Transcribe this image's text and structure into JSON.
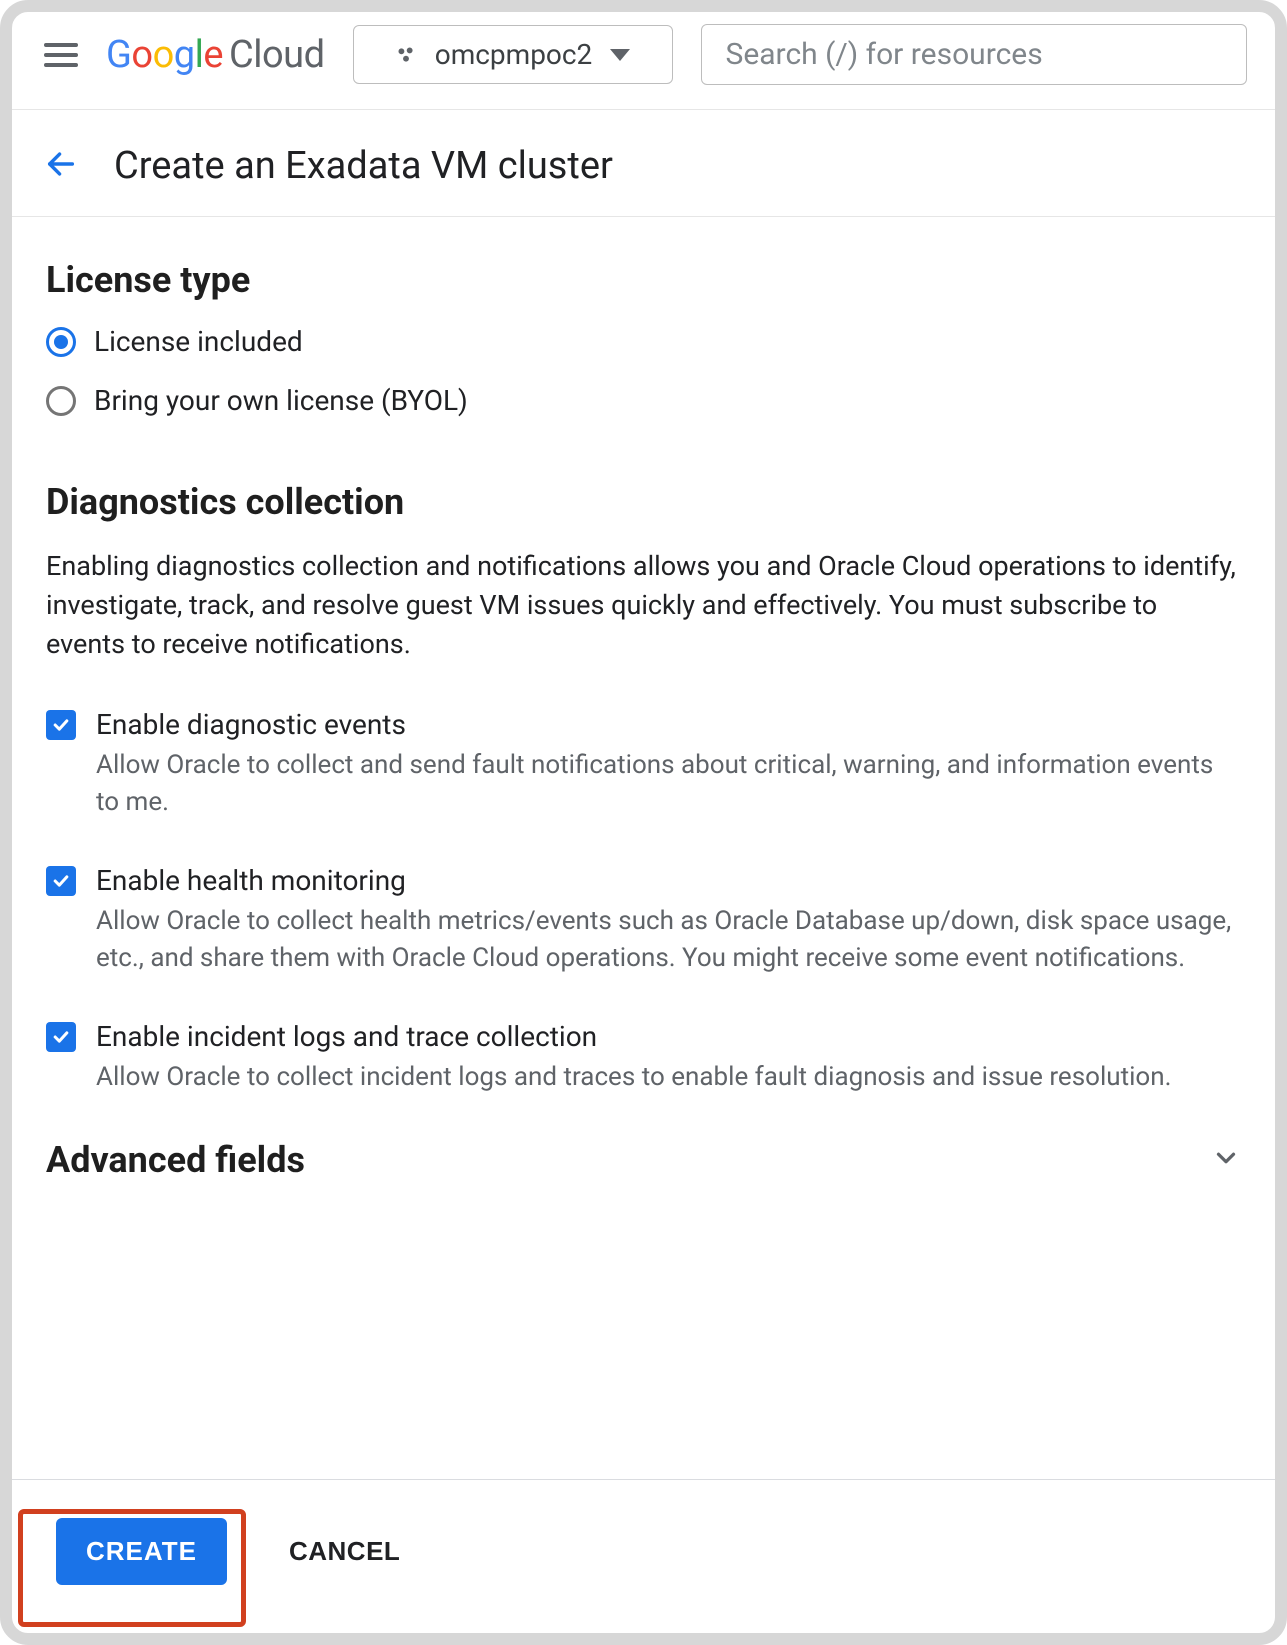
{
  "header": {
    "logo_text": "Google",
    "logo_suffix": "Cloud",
    "project_name": "omcpmpoc2",
    "search_placeholder": "Search (/) for resources"
  },
  "page": {
    "title": "Create an Exadata VM cluster"
  },
  "license": {
    "heading": "License type",
    "options": {
      "included": "License included",
      "byol": "Bring your own license (BYOL)"
    },
    "selected": "included"
  },
  "diagnostics": {
    "heading": "Diagnostics collection",
    "description": "Enabling diagnostics collection and notifications allows you and Oracle Cloud operations to identify, investigate, track, and resolve guest VM issues quickly and effectively. You must subscribe to events to receive notifications.",
    "items": [
      {
        "label": "Enable diagnostic events",
        "sub": "Allow Oracle to collect and send fault notifications about critical, warning, and information events to me.",
        "checked": true
      },
      {
        "label": "Enable health monitoring",
        "sub": "Allow Oracle to collect health metrics/events such as Oracle Database up/down, disk space usage, etc., and share them with Oracle Cloud operations. You might receive some event notifications.",
        "checked": true
      },
      {
        "label": "Enable incident logs and trace collection",
        "sub": "Allow Oracle to collect incident logs and traces to enable fault diagnosis and issue resolution.",
        "checked": true
      }
    ]
  },
  "advanced": {
    "heading": "Advanced fields"
  },
  "footer": {
    "create": "CREATE",
    "cancel": "CANCEL"
  }
}
